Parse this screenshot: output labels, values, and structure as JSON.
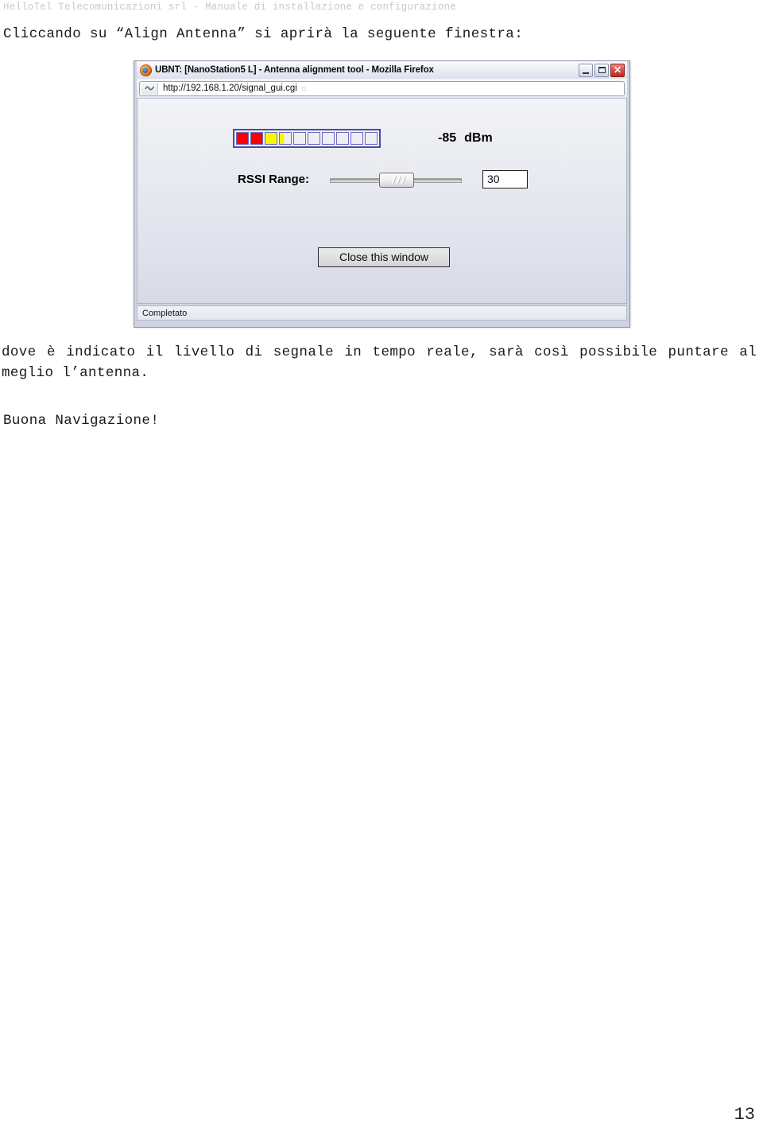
{
  "document": {
    "running_header": "HelloTel Telecomunicazioni srl - Manuale di installazione e configurazione",
    "intro_paragraph": "Cliccando su “Align Antenna” si aprirà la seguente finestra:",
    "after_paragraph": "dove è indicato il livello di segnale in tempo reale, sarà così possibile puntare al meglio l’antenna.",
    "closing_paragraph": "Buona Navigazione!",
    "page_number": "13"
  },
  "browser_window": {
    "favicon_name": "firefox-icon",
    "title": "UBNT: [NanoStation5 L] - Antenna alignment tool - Mozilla Firefox",
    "window_controls": {
      "minimize": "–",
      "maximize": "❑",
      "close": "✕"
    },
    "address_bar": {
      "url": "http://192.168.1.20/signal_gui.cgi",
      "site_icon_name": "page-favicon",
      "bookmark_star": "☆"
    },
    "status_bar": {
      "text": "Completato"
    }
  },
  "signal_tool": {
    "meter": {
      "total_segments": 10,
      "segments": [
        "red",
        "red",
        "yellow",
        "partial",
        "empty",
        "empty",
        "empty",
        "empty",
        "empty",
        "empty"
      ],
      "colors": {
        "red": "#fb0000",
        "yellow": "#fbf600",
        "empty": "#eeeef4",
        "border": "#4a4aa8"
      }
    },
    "signal_value": "-85",
    "signal_unit": "dBm",
    "rssi_label": "RSSI Range:",
    "rssi_value": "30",
    "rssi_slider": {
      "position_percent": 50
    },
    "close_button_label": "Close this window"
  }
}
